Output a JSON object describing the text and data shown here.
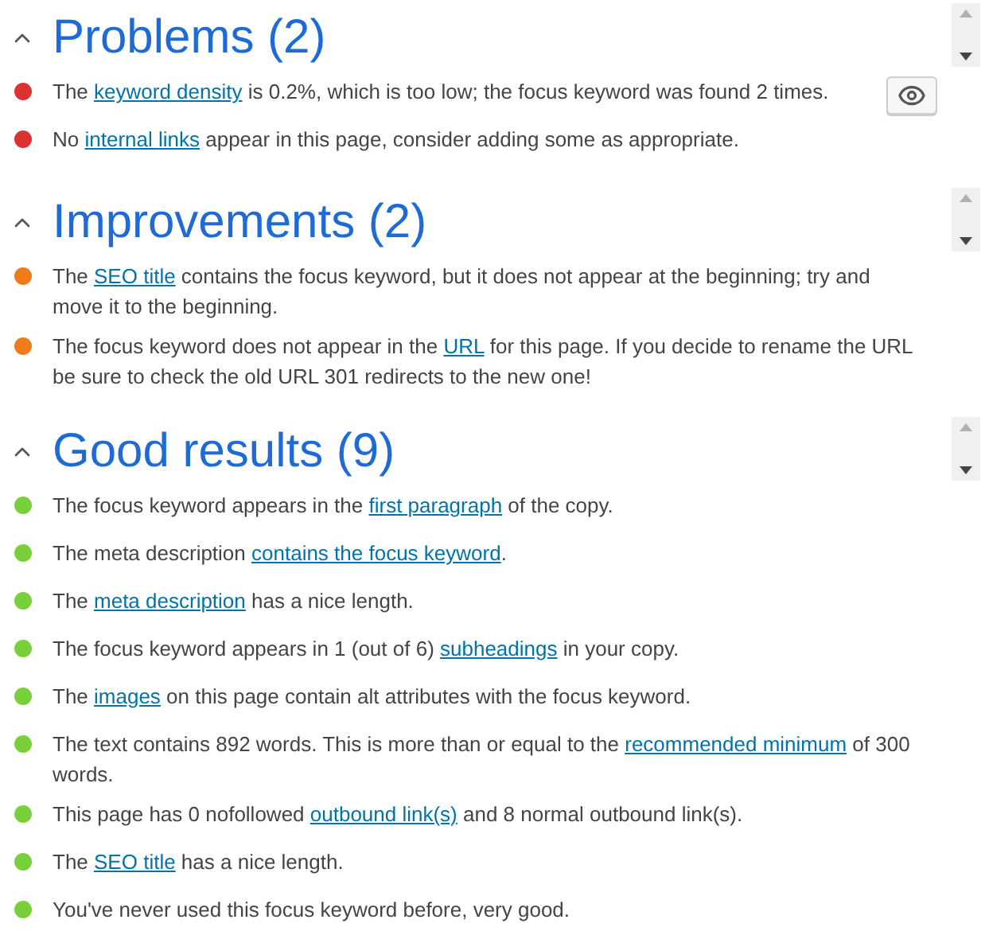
{
  "sections": [
    {
      "title": "Problems (2)",
      "expanded": true,
      "items": [
        {
          "color": "#dc3232",
          "marker": true,
          "parts": [
            {
              "kind": "text",
              "text": "The "
            },
            {
              "kind": "link",
              "text": "keyword density"
            },
            {
              "kind": "text",
              "text": " is 0.2%, which is too low; the focus keyword was found 2 times."
            }
          ]
        },
        {
          "color": "#dc3232",
          "marker": false,
          "parts": [
            {
              "kind": "text",
              "text": "No "
            },
            {
              "kind": "link",
              "text": "internal links"
            },
            {
              "kind": "text",
              "text": " appear in this page, consider adding some as appropriate."
            }
          ]
        }
      ]
    },
    {
      "title": "Improvements (2)",
      "expanded": true,
      "items": [
        {
          "color": "#ee7c1b",
          "marker": false,
          "parts": [
            {
              "kind": "text",
              "text": "The "
            },
            {
              "kind": "link",
              "text": "SEO title"
            },
            {
              "kind": "text",
              "text": " contains the focus keyword, but it does not appear at the beginning; try and move it to the beginning."
            }
          ]
        },
        {
          "color": "#ee7c1b",
          "marker": false,
          "parts": [
            {
              "kind": "text",
              "text": "The focus keyword does not appear in the "
            },
            {
              "kind": "link",
              "text": "URL"
            },
            {
              "kind": "text",
              "text": " for this page. If you decide to rename the URL be sure to check the old URL 301 redirects to the new one!"
            }
          ]
        }
      ]
    },
    {
      "title": "Good results (9)",
      "expanded": true,
      "items": [
        {
          "color": "#7ad03a",
          "marker": false,
          "parts": [
            {
              "kind": "text",
              "text": "The focus keyword appears in the "
            },
            {
              "kind": "link",
              "text": "first paragraph"
            },
            {
              "kind": "text",
              "text": " of the copy."
            }
          ]
        },
        {
          "color": "#7ad03a",
          "marker": false,
          "parts": [
            {
              "kind": "text",
              "text": "The meta description "
            },
            {
              "kind": "link",
              "text": "contains the focus keyword"
            },
            {
              "kind": "text",
              "text": "."
            }
          ]
        },
        {
          "color": "#7ad03a",
          "marker": false,
          "parts": [
            {
              "kind": "text",
              "text": "The "
            },
            {
              "kind": "link",
              "text": "meta description"
            },
            {
              "kind": "text",
              "text": " has a nice length."
            }
          ]
        },
        {
          "color": "#7ad03a",
          "marker": false,
          "parts": [
            {
              "kind": "text",
              "text": "The focus keyword appears in 1 (out of 6) "
            },
            {
              "kind": "link",
              "text": "subheadings"
            },
            {
              "kind": "text",
              "text": " in your copy."
            }
          ]
        },
        {
          "color": "#7ad03a",
          "marker": false,
          "parts": [
            {
              "kind": "text",
              "text": "The "
            },
            {
              "kind": "link",
              "text": "images"
            },
            {
              "kind": "text",
              "text": " on this page contain alt attributes with the focus keyword."
            }
          ]
        },
        {
          "color": "#7ad03a",
          "marker": false,
          "parts": [
            {
              "kind": "text",
              "text": "The text contains 892 words. This is more than or equal to the "
            },
            {
              "kind": "link",
              "text": "recommended minimum"
            },
            {
              "kind": "text",
              "text": " of 300 words."
            }
          ]
        },
        {
          "color": "#7ad03a",
          "marker": false,
          "parts": [
            {
              "kind": "text",
              "text": "This page has 0 nofollowed "
            },
            {
              "kind": "link",
              "text": "outbound link(s)"
            },
            {
              "kind": "text",
              "text": " and 8 normal outbound link(s)."
            }
          ]
        },
        {
          "color": "#7ad03a",
          "marker": false,
          "parts": [
            {
              "kind": "text",
              "text": "The "
            },
            {
              "kind": "link",
              "text": "SEO title"
            },
            {
              "kind": "text",
              "text": " has a nice length."
            }
          ]
        },
        {
          "color": "#7ad03a",
          "marker": false,
          "parts": [
            {
              "kind": "text",
              "text": "You've never used this focus keyword before, very good."
            }
          ]
        }
      ]
    }
  ]
}
